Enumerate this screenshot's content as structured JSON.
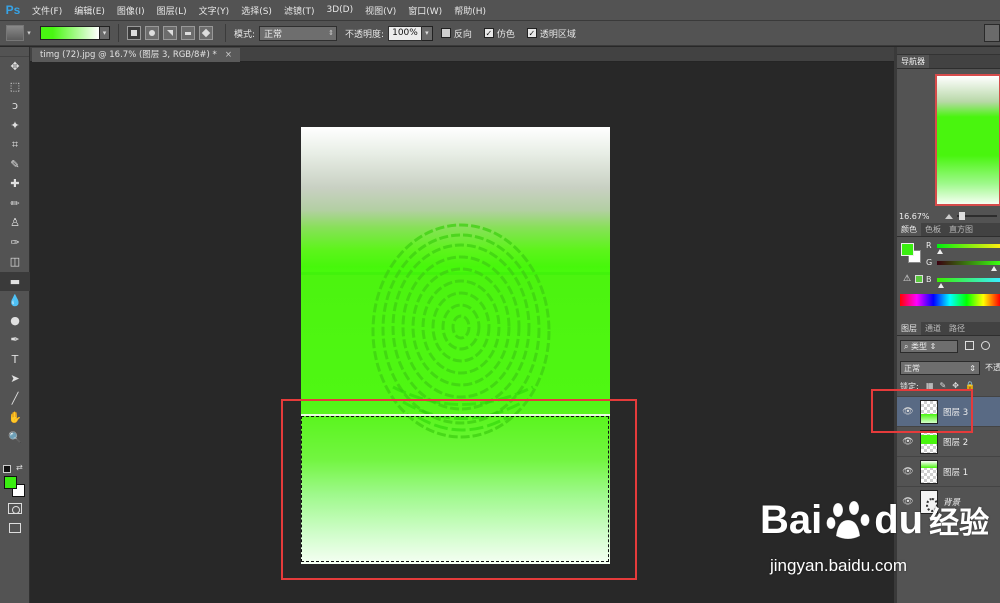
{
  "app": {
    "logo": "Ps"
  },
  "menu": [
    "文件(F)",
    "编辑(E)",
    "图像(I)",
    "图层(L)",
    "文字(Y)",
    "选择(S)",
    "滤镜(T)",
    "3D(D)",
    "视图(V)",
    "窗口(W)",
    "帮助(H)"
  ],
  "options": {
    "mode_label": "模式:",
    "mode_value": "正常",
    "opacity_label": "不透明度:",
    "opacity_value": "100%",
    "reverse_label": "反向",
    "reverse_checked": false,
    "dither_label": "仿色",
    "dither_checked": true,
    "transparency_label": "透明区域",
    "transparency_checked": true,
    "gradient_colors": [
      "#49f712",
      "#ffffff"
    ]
  },
  "document": {
    "tab_title": "timg (72).jpg @ 16.7% (图层 3, RGB/8#) *",
    "close": "×"
  },
  "tools": [
    "move-tool",
    "marquee-tool",
    "lasso-tool",
    "magic-wand-tool",
    "crop-tool",
    "eyedropper-tool",
    "healing-brush-tool",
    "brush-tool",
    "clone-stamp-tool",
    "history-brush-tool",
    "eraser-tool",
    "gradient-tool",
    "blur-tool",
    "dodge-tool",
    "pen-tool",
    "type-tool",
    "path-selection-tool",
    "line-tool",
    "hand-tool",
    "zoom-tool"
  ],
  "tool_glyphs": [
    "✥",
    "⬚",
    "ↄ",
    "✦",
    "⌗",
    "✎",
    "✚",
    "✏",
    "♙",
    "✑",
    "◫",
    "▬",
    "💧",
    "●",
    "✒",
    "T",
    "➤",
    "╱",
    "✋",
    "🔍"
  ],
  "colors": {
    "foreground": "#3aee10",
    "background": "#ffffff",
    "accent_red": "#e53b3b"
  },
  "navigator": {
    "tab": "导航器",
    "zoom": "16.67%"
  },
  "color_panel": {
    "tabs": [
      "颜色",
      "色板",
      "直方图"
    ],
    "channels": [
      "R",
      "G",
      "B"
    ]
  },
  "layers_panel": {
    "tabs": [
      "图层",
      "通道",
      "路径"
    ],
    "filter_label": "类型",
    "blend_mode": "正常",
    "opacity_label": "不透",
    "lock_label": "锁定:",
    "layers": [
      {
        "name": "图层 3",
        "selected": true,
        "thumb": "g1"
      },
      {
        "name": "图层 2",
        "selected": false,
        "thumb": "g2"
      },
      {
        "name": "图层 1",
        "selected": false,
        "thumb": "g3"
      },
      {
        "name": "背景",
        "selected": false,
        "thumb": "bgfp",
        "italic": true
      }
    ]
  },
  "watermark": {
    "brand": "Bai",
    "brand2": "du",
    "suffix": "经验",
    "url": "jingyan.baidu.com"
  }
}
